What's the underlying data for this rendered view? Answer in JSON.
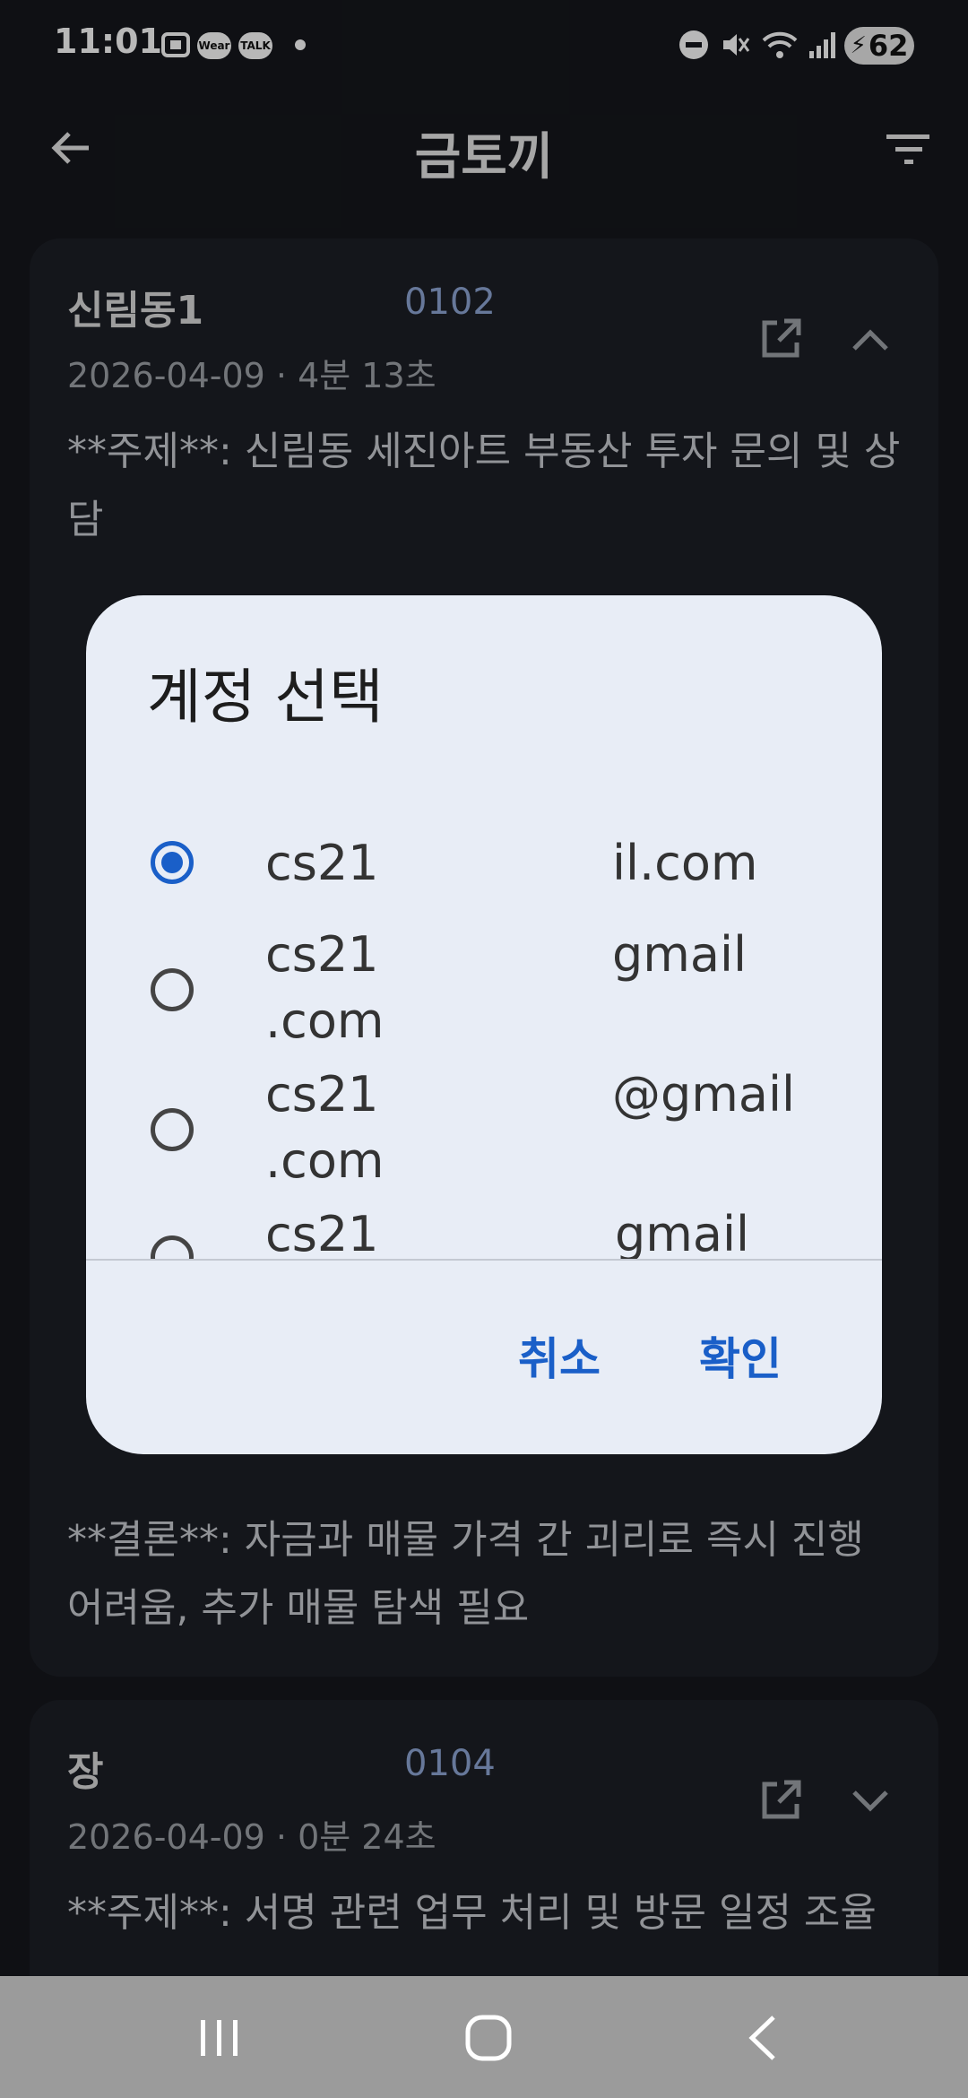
{
  "status_bar": {
    "time": "11:01",
    "icons": [
      "screenshot-icon",
      "wear-icon",
      "talk-icon",
      "dot-icon",
      "dnd-icon",
      "mute-icon",
      "wifi-icon",
      "signal-icon"
    ],
    "wear_label": "Wear",
    "talk_label": "TALK",
    "battery": "62"
  },
  "app_bar": {
    "title": "금토끼",
    "back_icon": "arrow-back-icon",
    "filter_icon": "filter-icon"
  },
  "cards": [
    {
      "name": "신림동1",
      "code": "0102",
      "meta": "2026-04-09 · 4분 13초",
      "summary": "**주제**: 신림동 세진아트 부동산 투자 문의 및 상담",
      "conclusion": "**결론**: 자금과 매물 가격 간 괴리로 즉시 진행 어려움, 추가 매물 탐색 필요",
      "expanded": true
    },
    {
      "name": "장",
      "code": "0104",
      "meta": "2026-04-09 · 0분 24초",
      "summary": "**주제**: 서명 관련 업무 처리 및 방문 일정 조율",
      "expanded": false
    }
  ],
  "dialog": {
    "title": "계정 선택",
    "options": [
      {
        "prefix": "cs21",
        "suffix": "il.com",
        "line2": "",
        "selected": true
      },
      {
        "prefix": "cs21",
        "suffix": "gmail",
        "line2": ".com",
        "selected": false
      },
      {
        "prefix": "cs21",
        "suffix": "@gmail",
        "line2": ".com",
        "selected": false
      },
      {
        "prefix": "cs21",
        "suffix": "gmail",
        "line2": "",
        "selected": false
      }
    ],
    "cancel_label": "취소",
    "confirm_label": "확인"
  },
  "colors": {
    "accent": "#1a5fc8",
    "background": "#15171c",
    "card": "#1c1f26",
    "dialog": "#e8edf6",
    "code": "#8fa7d6"
  }
}
